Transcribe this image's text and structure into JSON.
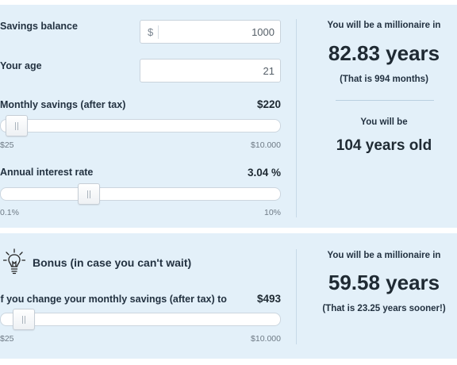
{
  "savings_balance": {
    "label": "Savings balance",
    "currency": "$",
    "value": "1000"
  },
  "age": {
    "label": "Your age",
    "value": "21"
  },
  "monthly_savings": {
    "label": "Monthly savings (after tax)",
    "value": "$220",
    "min_label": "$25",
    "max_label": "$10.000",
    "slider_fraction": 0.02
  },
  "interest_rate": {
    "label": "Annual interest rate",
    "value": "3.04 %",
    "min_label": "0.1%",
    "max_label": "10%",
    "slider_fraction": 0.3
  },
  "results": {
    "millionaire_label": "You will be a millionaire in",
    "years": "82.83 years",
    "months": "(That is 994 months)",
    "age_label": "You will be",
    "age_value": "104 years old"
  },
  "bonus": {
    "title": "Bonus (in case you can't wait)",
    "icon": "lightbulb-icon",
    "change_label": "If you change your monthly savings (after tax) to",
    "value": "$493",
    "min_label": "$25",
    "max_label": "$10.000",
    "slider_fraction": 0.047,
    "millionaire_label": "You will be a millionaire in",
    "years": "59.58 years",
    "sooner": "(That is 23.25 years sooner!)"
  },
  "colors": {
    "panel_background": "#e3f0f9",
    "text": "#1f2a33",
    "divider": "#c7d9e8"
  }
}
